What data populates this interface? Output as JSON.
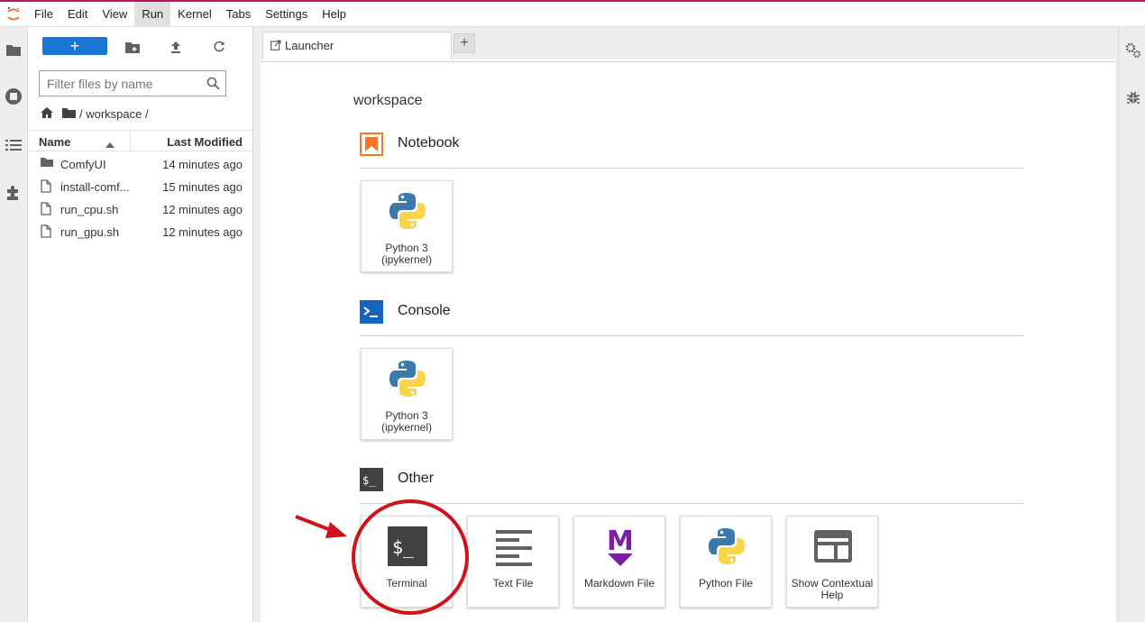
{
  "menubar": {
    "items": [
      "File",
      "Edit",
      "View",
      "Run",
      "Kernel",
      "Tabs",
      "Settings",
      "Help"
    ],
    "active": "Run"
  },
  "filebrowser": {
    "new_label": "+",
    "filter_placeholder": "Filter files by name",
    "breadcrumb": "/ workspace /",
    "columns": {
      "name": "Name",
      "modified": "Last Modified"
    },
    "files": [
      {
        "name": "ComfyUI",
        "type": "folder",
        "modified": "14 minutes ago"
      },
      {
        "name": "install-comf...",
        "type": "file",
        "modified": "15 minutes ago"
      },
      {
        "name": "run_cpu.sh",
        "type": "file",
        "modified": "12 minutes ago"
      },
      {
        "name": "run_gpu.sh",
        "type": "file",
        "modified": "12 minutes ago"
      }
    ]
  },
  "tabs": [
    {
      "label": "Launcher"
    }
  ],
  "add_tab_label": "+",
  "launcher": {
    "cwd": "workspace",
    "sections": {
      "notebook": {
        "label": "Notebook",
        "items": [
          {
            "label": "Python 3 (ipykernel)",
            "icon": "python-logo-icon"
          }
        ]
      },
      "console": {
        "label": "Console",
        "items": [
          {
            "label": "Python 3 (ipykernel)",
            "icon": "python-logo-icon"
          }
        ]
      },
      "other": {
        "label": "Other",
        "items": [
          {
            "label": "Terminal",
            "icon": "terminal-icon"
          },
          {
            "label": "Text File",
            "icon": "text-file-icon"
          },
          {
            "label": "Markdown File",
            "icon": "markdown-icon"
          },
          {
            "label": "Python File",
            "icon": "python-logo-icon"
          },
          {
            "label": "Show Contextual Help",
            "icon": "contextual-help-icon"
          }
        ]
      }
    }
  },
  "colors": {
    "accent": "#1976d2",
    "notebook_orange": "#f37726",
    "console_blue": "#0d47a1",
    "annotation_red": "#d0121b",
    "markdown_purple": "#7b1fa2"
  }
}
